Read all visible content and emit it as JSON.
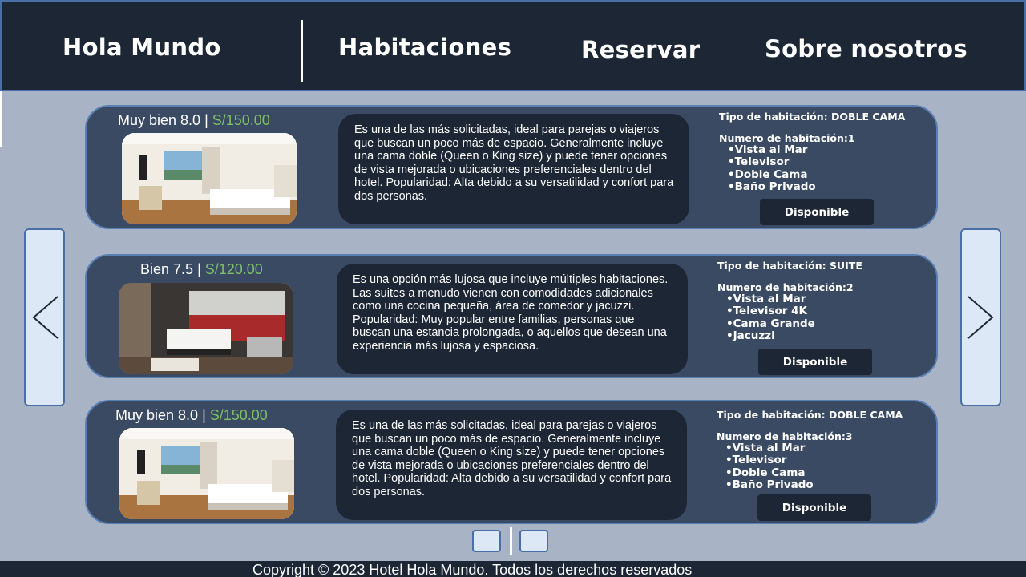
{
  "header": {
    "brand": "Hola Mundo",
    "nav": {
      "rooms": "Habitaciones",
      "book": "Reservar",
      "about": "Sobre nosotros"
    }
  },
  "rooms": [
    {
      "rating": "Muy bien 8.0",
      "separator": " | ",
      "price": "S/150.00",
      "description": "Es una de las más solicitadas, ideal para parejas o viajeros que buscan un poco más de espacio. Generalmente incluye una cama doble (Queen o King size) y puede tener opciones de vista mejorada o ubicaciones preferenciales dentro del hotel. Popularidad: Alta debido a su versatilidad y confort para dos personas.",
      "type": "Tipo de habitación: DOBLE CAMA",
      "number": "Numero de habitación:1",
      "features": [
        "Vista al Mar",
        "Televisor",
        "Doble Cama",
        "Baño Privado"
      ],
      "status": "Disponible"
    },
    {
      "rating": "Bien 7.5",
      "separator": " | ",
      "price": "S/120.00",
      "description": "Es una opción más lujosa que incluye múltiples habitaciones. Las suites a menudo vienen con comodidades adicionales como una cocina pequeña, área de comedor y jacuzzi. Popularidad: Muy popular entre familias, personas que buscan una estancia prolongada, o aquellos que desean una experiencia más lujosa y espaciosa.",
      "type": "Tipo de habitación: SUITE",
      "number": "Numero de habitación:2",
      "features": [
        "Vista al Mar",
        "Televisor 4K",
        "Cama Grande",
        "Jacuzzi"
      ],
      "status": "Disponible"
    },
    {
      "rating": "Muy bien 8.0",
      "separator": " | ",
      "price": "S/150.00",
      "description": "Es una de las más solicitadas, ideal para parejas o viajeros que buscan un poco más de espacio. Generalmente incluye una cama doble (Queen o King size) y puede tener opciones de vista mejorada o ubicaciones preferenciales dentro del hotel. Popularidad: Alta debido a su versatilidad y confort para dos personas.",
      "type": "Tipo de habitación: DOBLE CAMA",
      "number": "Numero de habitación:3",
      "features": [
        "Vista al Mar",
        "Televisor",
        "Doble Cama",
        "Baño Privado"
      ],
      "status": "Disponible"
    }
  ],
  "footer": {
    "copyright": "Copyright © 2023 Hotel Hola Mundo. Todos los derechos reservados"
  },
  "colors": {
    "header_bg": "#1d2634",
    "page_bg": "#a9b3c6",
    "card_bg": "#3a4a63",
    "price": "#7dc06a",
    "button_bg": "#dce8f5"
  }
}
